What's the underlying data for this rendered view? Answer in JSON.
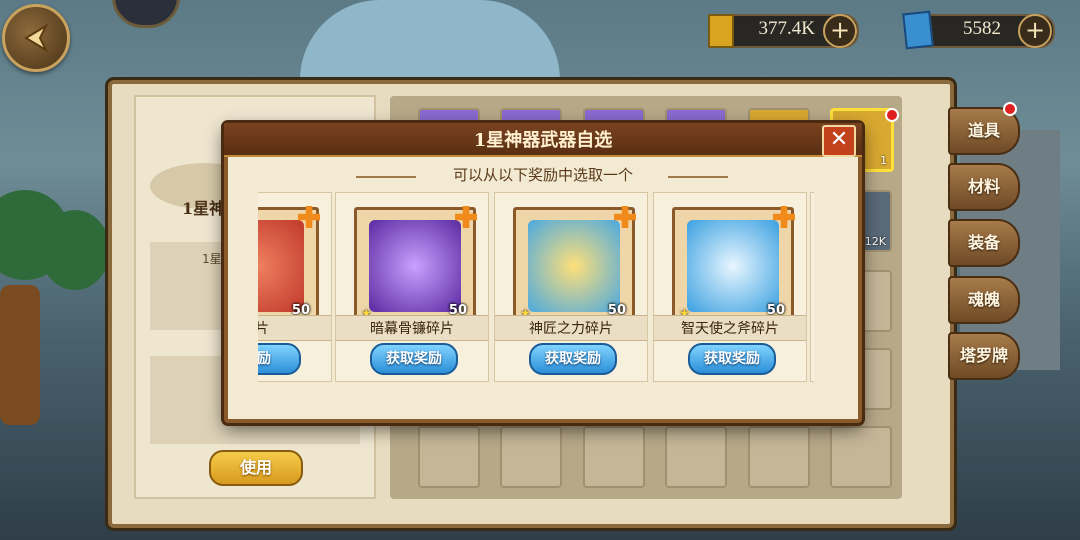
{
  "topbar": {
    "gold_value": "377.4K",
    "gem_value": "5582",
    "plus_label": "+"
  },
  "panel": {
    "left_title": "1星神",
    "left_label": "1星",
    "use_label": "使用"
  },
  "tabs": [
    {
      "label": "道具",
      "active": true,
      "notify": true
    },
    {
      "label": "材料"
    },
    {
      "label": "装备"
    },
    {
      "label": "魂魄"
    },
    {
      "label": "塔罗牌"
    }
  ],
  "grid_counts": {
    "slot_2_2": "12K",
    "slot_1_6": "1"
  },
  "dialog": {
    "title": "1星神器武器自选",
    "close_label": "✕",
    "subtitle": "可以从以下奖励中选取一个",
    "rewards": [
      {
        "name": "碎片",
        "count": "50",
        "color": "#c0392b",
        "button": "奖励"
      },
      {
        "name": "暗幕骨镰碎片",
        "count": "50",
        "color": "#6a3cc0",
        "button": "获取奖励"
      },
      {
        "name": "神匠之力碎片",
        "count": "50",
        "color": "#d99a1a",
        "button": "获取奖励"
      },
      {
        "name": "智天使之斧碎片",
        "count": "50",
        "color": "#3aa0e0",
        "button": "获取奖励"
      }
    ]
  },
  "colors": {
    "accent": "#8b5a2b",
    "button_blue": "#2c8fd8",
    "button_gold": "#d79a1e"
  }
}
